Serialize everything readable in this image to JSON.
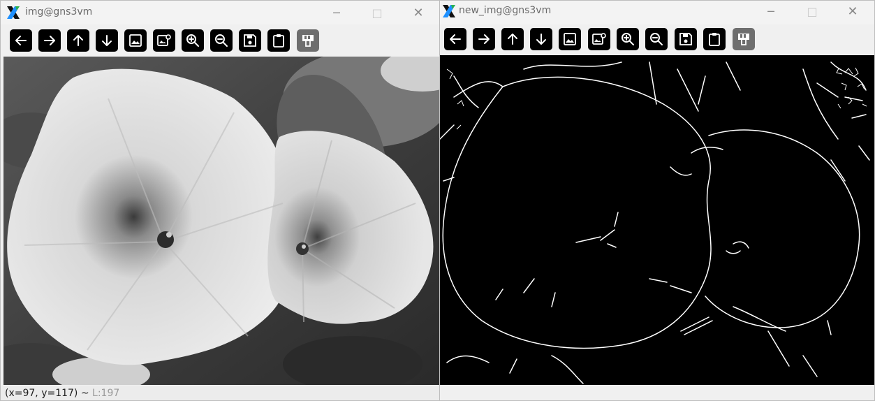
{
  "windows": [
    {
      "title": "img@gns3vm",
      "controls": {
        "minimize": "─",
        "maximize": "□",
        "close": "✕"
      },
      "status": {
        "coords": "(x=97, y=117) ~ ",
        "level": "L:197"
      }
    },
    {
      "title": "new_img@gns3vm",
      "controls": {
        "minimize": "─",
        "maximize": "□",
        "close": "✕"
      }
    }
  ],
  "toolbar_icons": [
    "arrow-left-icon",
    "arrow-right-icon",
    "arrow-up-icon",
    "arrow-down-icon",
    "image-icon",
    "image-settings-icon",
    "zoom-in-icon",
    "zoom-out-icon",
    "save-icon",
    "clipboard-icon",
    "save-alt-icon"
  ],
  "colors": {
    "toolbar_button": "#000000",
    "toolbar_button_disabled": "#6e6e6e",
    "edge_background": "#000000",
    "edge_lines": "#ffffff"
  }
}
